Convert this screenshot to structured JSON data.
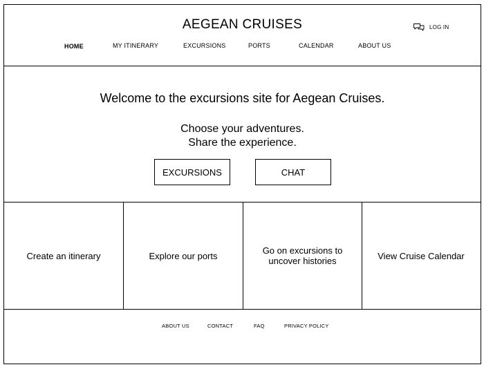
{
  "header": {
    "site_title": "AEGEAN CRUISES",
    "login_label": "LOG IN",
    "login_icon": "chat-bubbles-icon",
    "nav": [
      {
        "label": "HOME",
        "active": true
      },
      {
        "label": "MY ITINERARY",
        "active": false
      },
      {
        "label": "EXCURSIONS",
        "active": false
      },
      {
        "label": "PORTS",
        "active": false
      },
      {
        "label": "CALENDAR",
        "active": false
      },
      {
        "label": "ABOUT US",
        "active": false
      }
    ]
  },
  "hero": {
    "welcome": "Welcome to the excursions site for Aegean Cruises.",
    "tagline_line1": "Choose your adventures.",
    "tagline_line2": "Share the experience.",
    "buttons": [
      "EXCURSIONS",
      "CHAT"
    ]
  },
  "cards": [
    "Create an itinerary",
    "Explore our ports",
    "Go on excursions to uncover histories",
    "View Cruise Calendar"
  ],
  "footer": {
    "links": [
      "ABOUT US",
      "CONTACT",
      "FAQ",
      "PRIVACY POLICY"
    ]
  }
}
